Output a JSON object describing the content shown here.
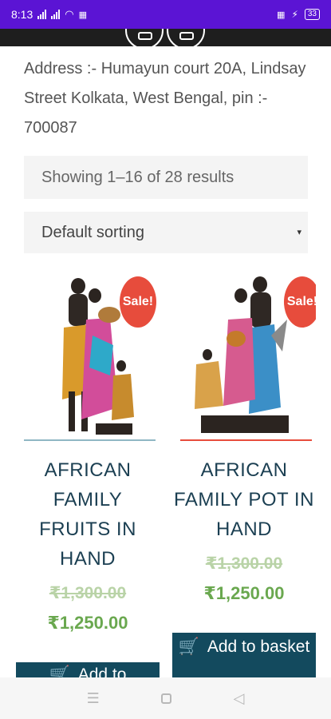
{
  "status_bar": {
    "time": "8:13",
    "battery": "33"
  },
  "address": "Address :- Humayun court 20A, Lindsay Street Kolkata, West Bengal, pin :- 700087",
  "result_count": "Showing 1–16 of 28 results",
  "sorting": {
    "selected": "Default sorting",
    "arrow": "▾"
  },
  "products": [
    {
      "title": "AFRICAN FAMILY FRUITS IN HAND",
      "badge": "Sale!",
      "old_price": "₹1,300.00",
      "new_price": "₹1,250.00",
      "button": "Add to",
      "divider_color": "#8fb7c4"
    },
    {
      "title": "AFRICAN FAMILY POT IN HAND",
      "badge": "Sale!",
      "old_price": "₹1,300.00",
      "new_price": "₹1,250.00",
      "button": "Add to basket",
      "divider_color": "#e74c3c"
    }
  ],
  "colors": {
    "status_bar": "#5b14d4",
    "title": "#1b3f52",
    "price": "#6aa84f",
    "button": "#134a5e",
    "badge": "#e74c3c"
  },
  "icons": {
    "cart": "cart-icon",
    "nav_menu": "menu-icon",
    "nav_home": "home-icon",
    "nav_back": "back-icon"
  }
}
